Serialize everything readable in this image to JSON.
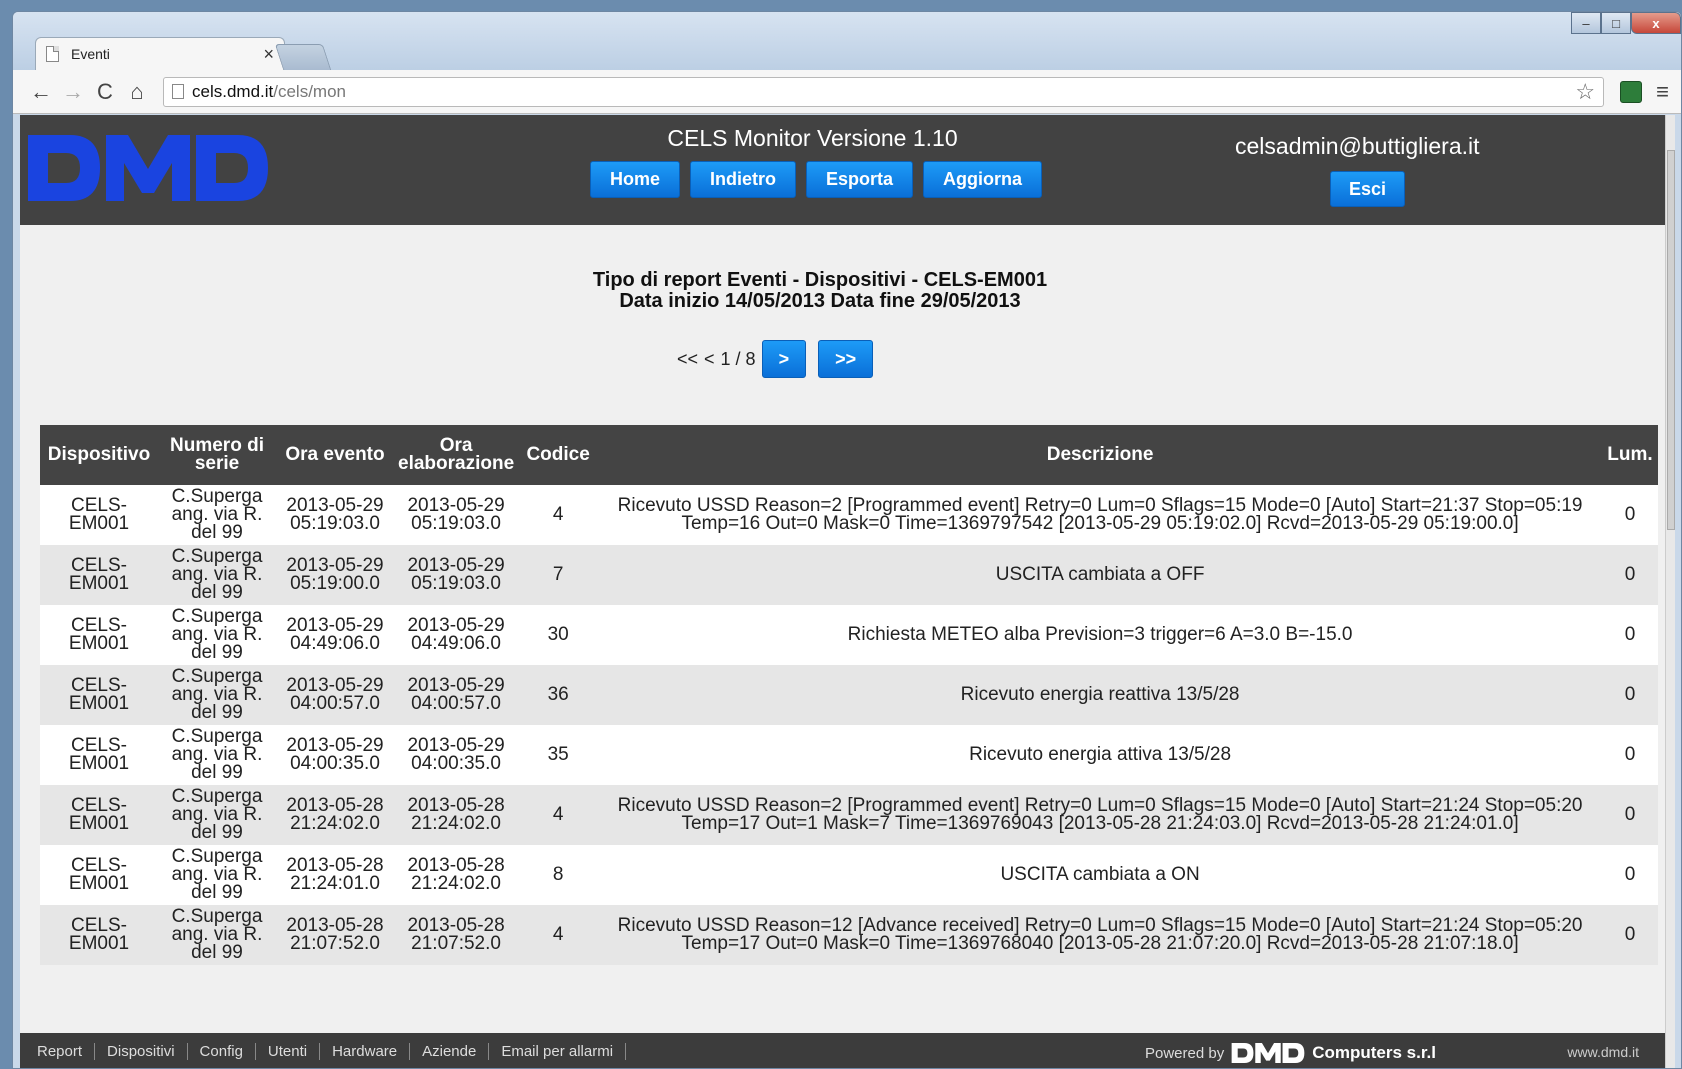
{
  "browser": {
    "tab_title": "Eventi",
    "tab_close": "×",
    "url_host": "cels.dmd.it",
    "url_path": "/cels/mon",
    "win_min": "–",
    "win_max": "□",
    "win_close": "x",
    "nav_back": "←",
    "nav_forward": "→",
    "nav_reload": "C",
    "nav_home": "⌂",
    "star": "☆",
    "menu": "≡"
  },
  "header": {
    "title": "CELS Monitor Versione 1.10",
    "nav": [
      "Home",
      "Indietro",
      "Esporta",
      "Aggiorna"
    ],
    "user_email": "celsadmin@buttigliera.it",
    "logout_label": "Esci",
    "logo_color": "#1a44e0"
  },
  "report": {
    "line1": "Tipo di report Eventi - Dispositivi - CELS-EM001",
    "line2": "Data inizio 14/05/2013 Data fine 29/05/2013"
  },
  "pager": {
    "first": "<<",
    "prev": "<",
    "current": "1 / 8",
    "next": ">",
    "last": ">>"
  },
  "table": {
    "headers": [
      "Dispositivo",
      "Numero di serie",
      "Ora evento",
      "Ora elaborazione",
      "Codice",
      "Descrizione",
      "Lum."
    ],
    "rows": [
      [
        "CELS-EM001",
        "C.Superga ang. via R. del 99",
        "2013-05-29 05:19:03.0",
        "2013-05-29 05:19:03.0",
        "4",
        "Ricevuto USSD Reason=2 [Programmed event] Retry=0 Lum=0 Sflags=15 Mode=0 [Auto] Start=21:37 Stop=05:19 Temp=16 Out=0 Mask=0 Time=1369797542 [2013-05-29 05:19:02.0] Rcvd=2013-05-29 05:19:00.0]",
        "0"
      ],
      [
        "CELS-EM001",
        "C.Superga ang. via R. del 99",
        "2013-05-29 05:19:00.0",
        "2013-05-29 05:19:03.0",
        "7",
        "USCITA cambiata a OFF",
        "0"
      ],
      [
        "CELS-EM001",
        "C.Superga ang. via R. del 99",
        "2013-05-29 04:49:06.0",
        "2013-05-29 04:49:06.0",
        "30",
        "Richiesta METEO alba Prevision=3 trigger=6 A=3.0 B=-15.0",
        "0"
      ],
      [
        "CELS-EM001",
        "C.Superga ang. via R. del 99",
        "2013-05-29 04:00:57.0",
        "2013-05-29 04:00:57.0",
        "36",
        "Ricevuto energia reattiva 13/5/28",
        "0"
      ],
      [
        "CELS-EM001",
        "C.Superga ang. via R. del 99",
        "2013-05-29 04:00:35.0",
        "2013-05-29 04:00:35.0",
        "35",
        "Ricevuto energia attiva 13/5/28",
        "0"
      ],
      [
        "CELS-EM001",
        "C.Superga ang. via R. del 99",
        "2013-05-28 21:24:02.0",
        "2013-05-28 21:24:02.0",
        "4",
        "Ricevuto USSD Reason=2 [Programmed event] Retry=0 Lum=0 Sflags=15 Mode=0 [Auto] Start=21:24 Stop=05:20 Temp=17 Out=1 Mask=7 Time=1369769043 [2013-05-28 21:24:03.0] Rcvd=2013-05-28 21:24:01.0]",
        "0"
      ],
      [
        "CELS-EM001",
        "C.Superga ang. via R. del 99",
        "2013-05-28 21:24:01.0",
        "2013-05-28 21:24:02.0",
        "8",
        "USCITA cambiata a ON",
        "0"
      ],
      [
        "CELS-EM001",
        "C.Superga ang. via R. del 99",
        "2013-05-28 21:07:52.0",
        "2013-05-28 21:07:52.0",
        "4",
        "Ricevuto USSD Reason=12 [Advance received] Retry=0 Lum=0 Sflags=15 Mode=0 [Auto] Start=21:24 Stop=05:20 Temp=17 Out=0 Mask=0 Time=1369768040 [2013-05-28 21:07:20.0] Rcvd=2013-05-28 21:07:18.0]",
        "0"
      ]
    ]
  },
  "footer": {
    "links": [
      "Report",
      "Dispositivi",
      "Config",
      "Utenti",
      "Hardware",
      "Aziende",
      "Email per allarmi"
    ],
    "powered_by": "Powered by",
    "company": "Computers s.r.l",
    "site": "www.dmd.it"
  }
}
